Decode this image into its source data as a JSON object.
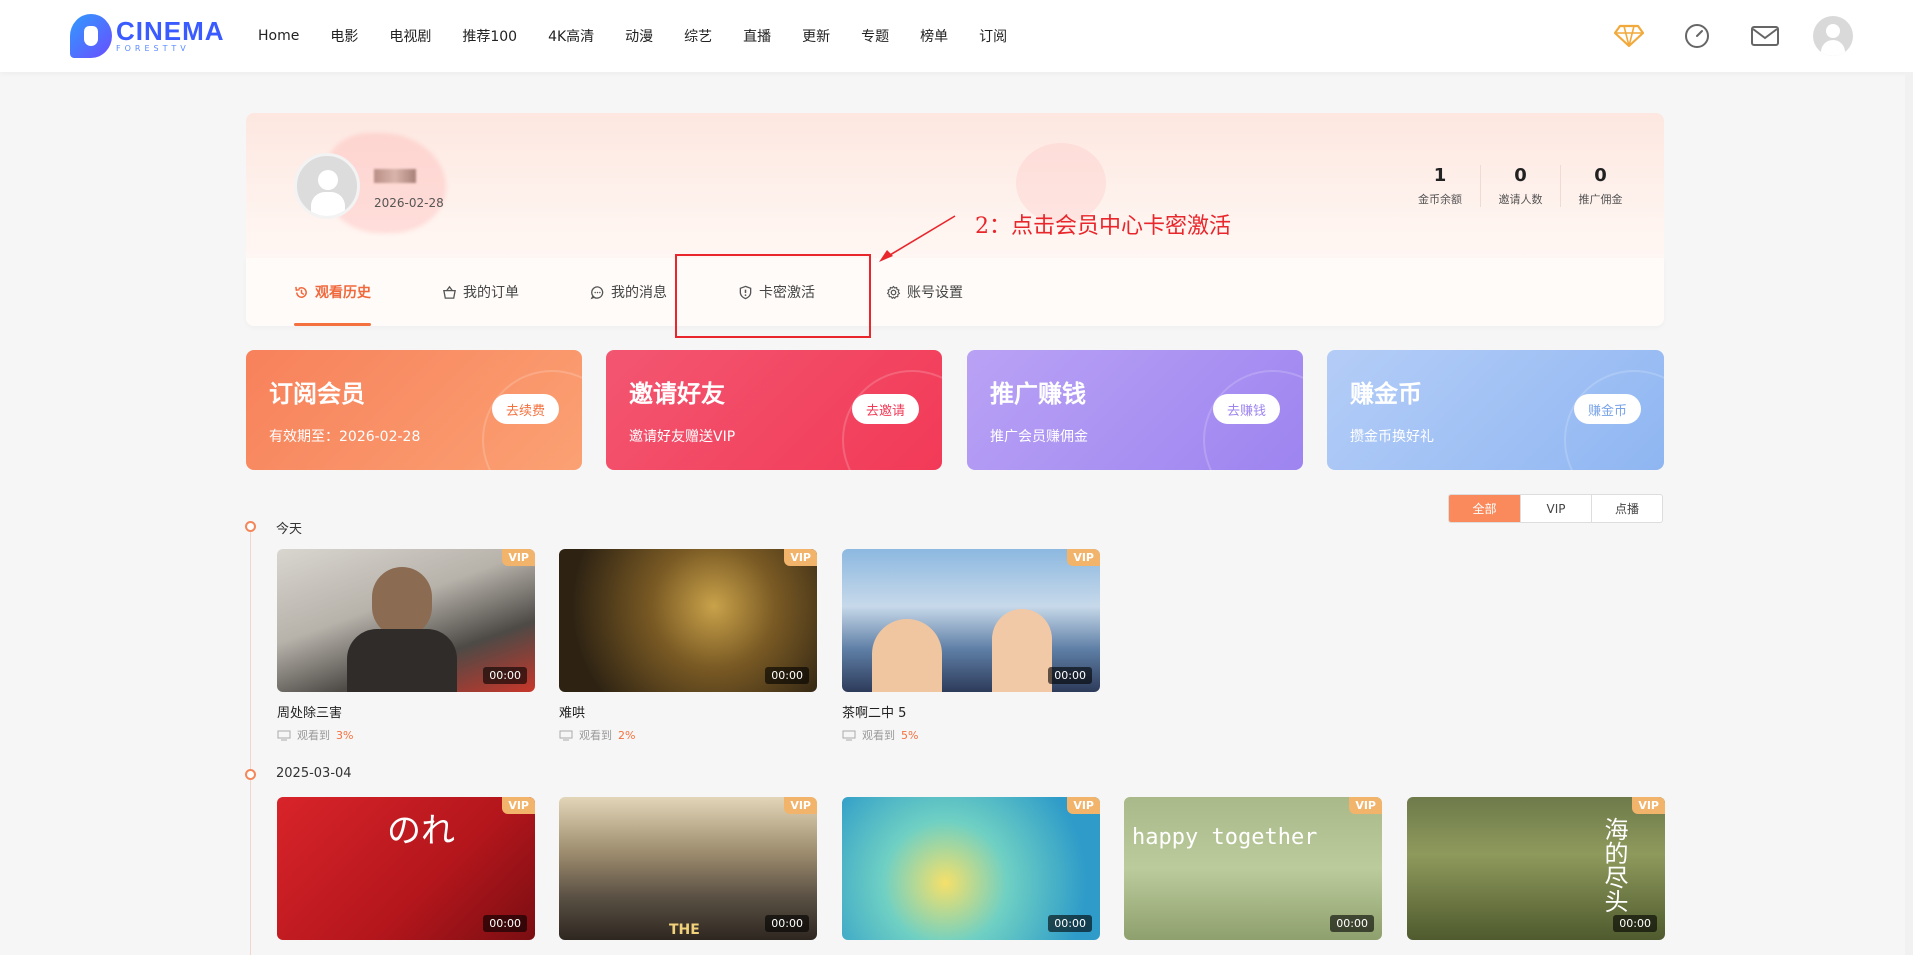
{
  "header": {
    "logo_main": "CINEMA",
    "logo_sub": "FORESTTV",
    "nav": [
      "Home",
      "电影",
      "电视剧",
      "推荐100",
      "4K高清",
      "动漫",
      "综艺",
      "直播",
      "更新",
      "专题",
      "榜单",
      "订阅"
    ]
  },
  "profile": {
    "date": "2026-02-28",
    "stats": [
      {
        "value": "1",
        "label": "金币余额"
      },
      {
        "value": "0",
        "label": "邀请人数"
      },
      {
        "value": "0",
        "label": "推广佣金"
      }
    ]
  },
  "annotation": "2：点击会员中心卡密激活",
  "tabs": [
    {
      "label": "观看历史",
      "icon": "history-icon"
    },
    {
      "label": "我的订单",
      "icon": "basket-icon"
    },
    {
      "label": "我的消息",
      "icon": "message-icon"
    },
    {
      "label": "卡密激活",
      "icon": "shield-icon"
    },
    {
      "label": "账号设置",
      "icon": "gear-icon"
    }
  ],
  "promos": [
    {
      "title": "订阅会员",
      "subtitle": "有效期至：2026-02-28",
      "button": "去续费",
      "color": "#f4713f"
    },
    {
      "title": "邀请好友",
      "subtitle": "邀请好友赠送VIP",
      "button": "去邀请",
      "color": "#f23a57"
    },
    {
      "title": "推广赚钱",
      "subtitle": "推广会员赚佣金",
      "button": "去赚钱",
      "color": "#9d84f0"
    },
    {
      "title": "赚金币",
      "subtitle": "攒金币换好礼",
      "button": "赚金币",
      "color": "#8fb6f2"
    }
  ],
  "filters": [
    "全部",
    "VIP",
    "点播"
  ],
  "history": {
    "groups": [
      {
        "date": "今天",
        "items": [
          {
            "title": "周处除三害",
            "badge": "VIP",
            "duration": "00:00",
            "progress_label": "观看到",
            "progress": "3%"
          },
          {
            "title": "难哄",
            "badge": "VIP",
            "duration": "00:00",
            "progress_label": "观看到",
            "progress": "2%"
          },
          {
            "title": "茶啊二中 5",
            "badge": "VIP",
            "duration": "00:00",
            "progress_label": "观看到",
            "progress": "5%"
          }
        ]
      },
      {
        "date": "2025-03-04",
        "items": [
          {
            "badge": "VIP",
            "duration": "00:00",
            "poster_text": "のれ"
          },
          {
            "badge": "VIP",
            "duration": "00:00",
            "poster_text": "THE"
          },
          {
            "badge": "VIP",
            "duration": "00:00",
            "poster_text": ""
          },
          {
            "badge": "VIP",
            "duration": "00:00",
            "poster_text": "happy together"
          },
          {
            "badge": "VIP",
            "duration": "00:00",
            "poster_text": "海的尽头"
          }
        ]
      }
    ]
  }
}
